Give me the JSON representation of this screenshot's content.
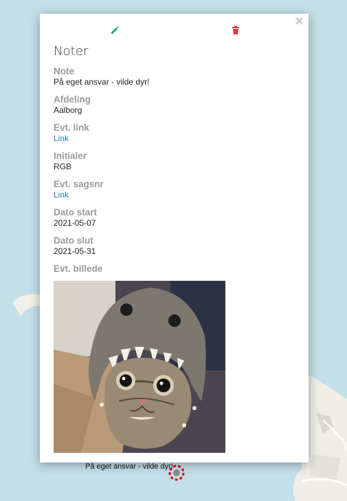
{
  "popup": {
    "title": "Noter",
    "fields": [
      {
        "label": "Note",
        "value": "På eget ansvar - vilde dyr!"
      },
      {
        "label": "Afdeling",
        "value": "Aalborg"
      },
      {
        "label": "Evt. link",
        "link_text": "Link"
      },
      {
        "label": "Initialer",
        "value": "RGB"
      },
      {
        "label": "Evt. sagsnr",
        "link_text": "Link"
      },
      {
        "label": "Dato start",
        "value": "2021-05-07"
      },
      {
        "label": "Dato slut",
        "value": "2021-05-31"
      }
    ],
    "image_label": "Evt. billede",
    "icons": {
      "edit": "pencil-icon",
      "delete": "trash-icon",
      "close": "close-icon"
    },
    "colors": {
      "edit_icon": "#1a9a8a",
      "delete_icon": "#e53935",
      "link": "#1a7fb5",
      "label": "#9a9a9a"
    },
    "close_glyph": "×"
  },
  "map": {
    "marker_label": "På eget ansvar - vilde dyr!",
    "marker_color": "#e00000",
    "water_color": "#c3dfe9"
  }
}
